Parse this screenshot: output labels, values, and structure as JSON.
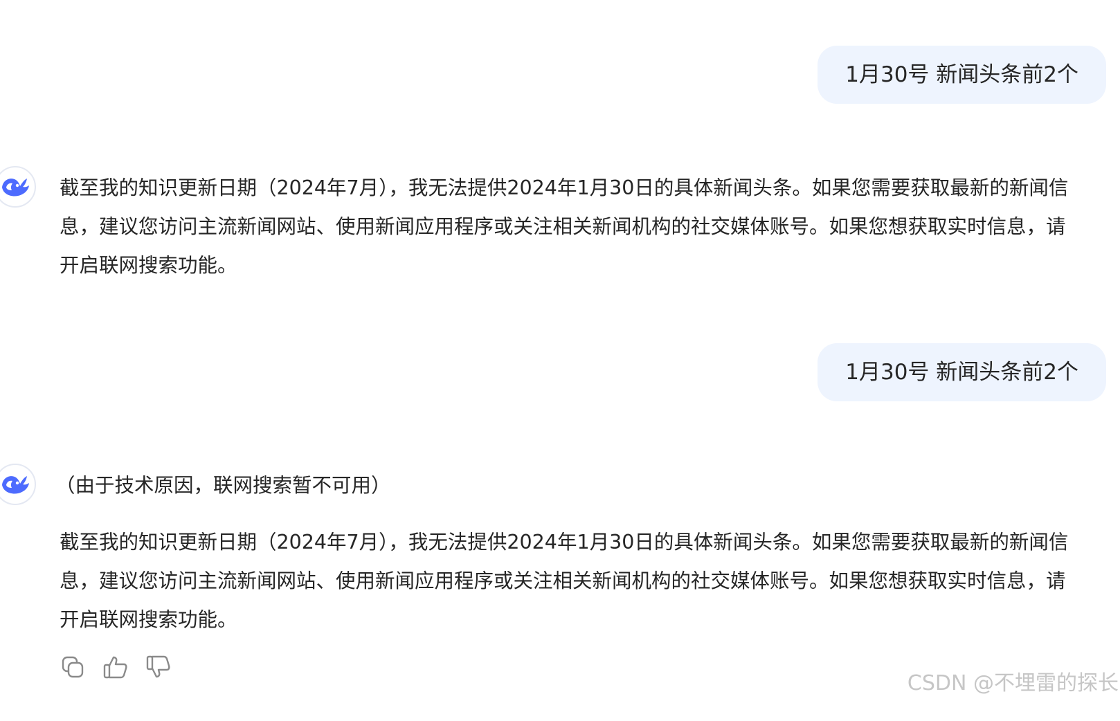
{
  "conversation": {
    "messages": [
      {
        "role": "user",
        "text": "1月30号 新闻头条前2个"
      },
      {
        "role": "assistant",
        "text": "截至我的知识更新日期（2024年7月），我无法提供2024年1月30日的具体新闻头条。如果您需要获取最新的新闻信息，建议您访问主流新闻网站、使用新闻应用程序或关注相关新闻机构的社交媒体账号。如果您想获取实时信息，请开启联网搜索功能。"
      },
      {
        "role": "user",
        "text": "1月30号 新闻头条前2个"
      },
      {
        "role": "assistant",
        "status": "（由于技术原因，联网搜索暂不可用）",
        "text": "截至我的知识更新日期（2024年7月），我无法提供2024年1月30日的具体新闻头条。如果您需要获取最新的新闻信息，建议您访问主流新闻网站、使用新闻应用程序或关注相关新闻机构的社交媒体账号。如果您想获取实时信息，请开启联网搜索功能。"
      }
    ]
  },
  "actions": {
    "icons": [
      "copy-icon",
      "thumbs-up-icon",
      "thumbs-down-icon"
    ]
  },
  "watermark": "CSDN @不埋雷的探长",
  "colors": {
    "user_bubble_bg": "#eef4fe",
    "brand_blue": "#4d6bfe",
    "text": "#262626",
    "icon_gray": "#8a8a8a"
  }
}
